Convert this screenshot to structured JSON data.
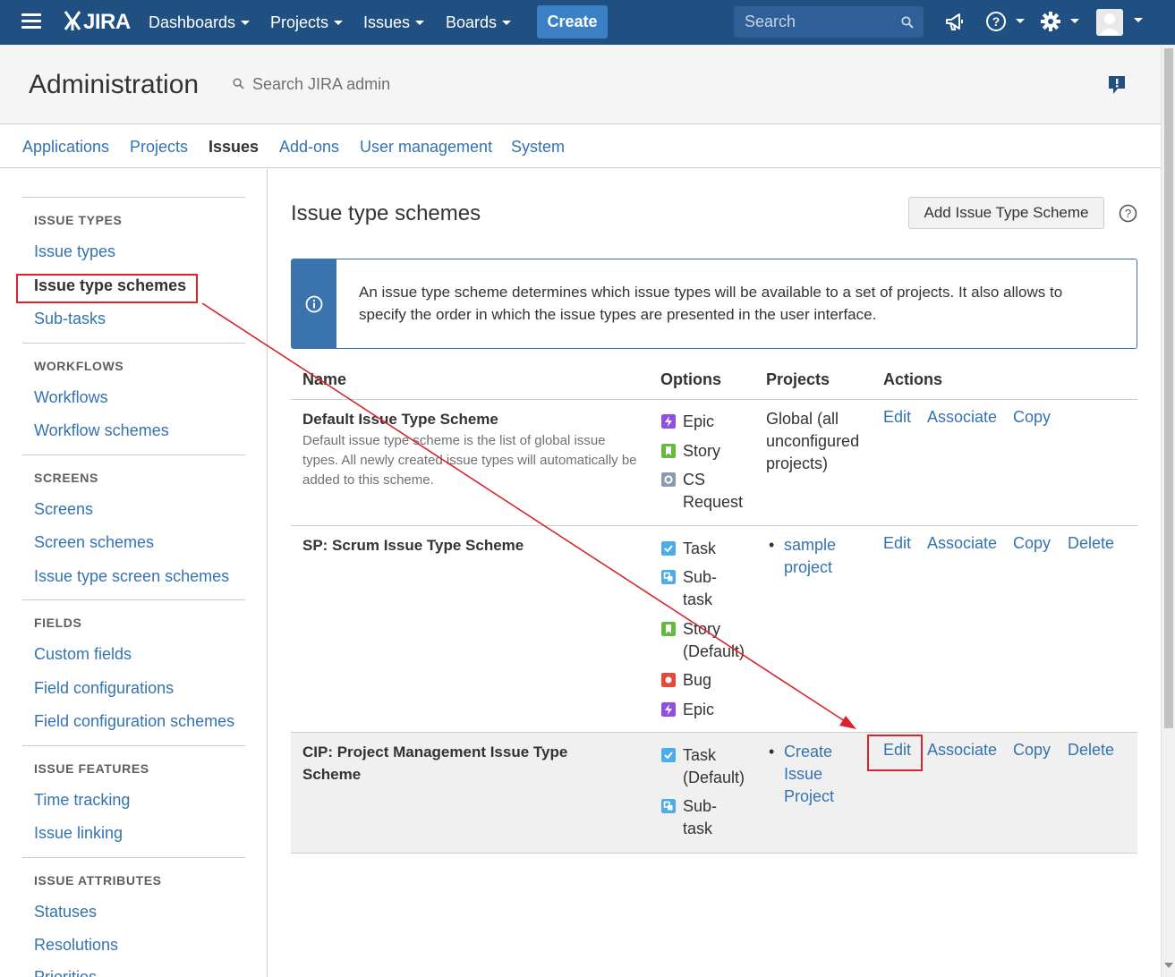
{
  "topnav": {
    "logo": "JIRA",
    "menus": [
      "Dashboards",
      "Projects",
      "Issues",
      "Boards"
    ],
    "create_label": "Create",
    "search_placeholder": "Search",
    "colors": {
      "bar": "#205081",
      "create": "#3b7fc4"
    }
  },
  "admin": {
    "title": "Administration",
    "search_placeholder": "Search JIRA admin",
    "tabs": [
      "Applications",
      "Projects",
      "Issues",
      "Add-ons",
      "User management",
      "System"
    ],
    "active_tab": "Issues"
  },
  "sidebar": {
    "sections": [
      {
        "heading": "ISSUE TYPES",
        "items": [
          "Issue types",
          "Issue type schemes",
          "Sub-tasks"
        ]
      },
      {
        "heading": "WORKFLOWS",
        "items": [
          "Workflows",
          "Workflow schemes"
        ]
      },
      {
        "heading": "SCREENS",
        "items": [
          "Screens",
          "Screen schemes",
          "Issue type screen schemes"
        ]
      },
      {
        "heading": "FIELDS",
        "items": [
          "Custom fields",
          "Field configurations",
          "Field configuration schemes"
        ]
      },
      {
        "heading": "ISSUE FEATURES",
        "items": [
          "Time tracking",
          "Issue linking"
        ]
      },
      {
        "heading": "ISSUE ATTRIBUTES",
        "items": [
          "Statuses",
          "Resolutions",
          "Priorities"
        ]
      }
    ],
    "active_item": "Issue type schemes"
  },
  "main": {
    "title": "Issue type schemes",
    "add_button": "Add Issue Type Scheme",
    "info": "An issue type scheme determines which issue types will be available to a set of projects. It also allows to specify the order in which the issue types are presented in the user interface.",
    "table": {
      "headers": [
        "Name",
        "Options",
        "Projects",
        "Actions"
      ],
      "rows": [
        {
          "name": "Default Issue Type Scheme",
          "description": "Default issue type scheme is the list of global issue types. All newly created issue types will automatically be added to this scheme.",
          "options": [
            "Epic",
            "Story",
            "CS Request"
          ],
          "projects_text": "Global (all unconfigured projects)",
          "actions": [
            "Edit",
            "Associate",
            "Copy"
          ]
        },
        {
          "name": "SP: Scrum Issue Type Scheme",
          "options": [
            "Task",
            "Sub-task",
            "Story (Default)",
            "Bug",
            "Epic"
          ],
          "projects": [
            "sample project"
          ],
          "actions": [
            "Edit",
            "Associate",
            "Copy",
            "Delete"
          ]
        },
        {
          "name": "CIP: Project Management Issue Type Scheme",
          "options": [
            "Task (Default)",
            "Sub-task"
          ],
          "projects": [
            "Create Issue Project"
          ],
          "actions": [
            "Edit",
            "Associate",
            "Copy",
            "Delete"
          ]
        }
      ]
    }
  },
  "issue_type_colors": {
    "epic": "#904ee2",
    "story": "#63ba3c",
    "cs-request": "#8b9aad",
    "task": "#4bade8",
    "sub-task": "#4bade8",
    "bug": "#e5493a"
  },
  "annotation_color": "#d9232d"
}
